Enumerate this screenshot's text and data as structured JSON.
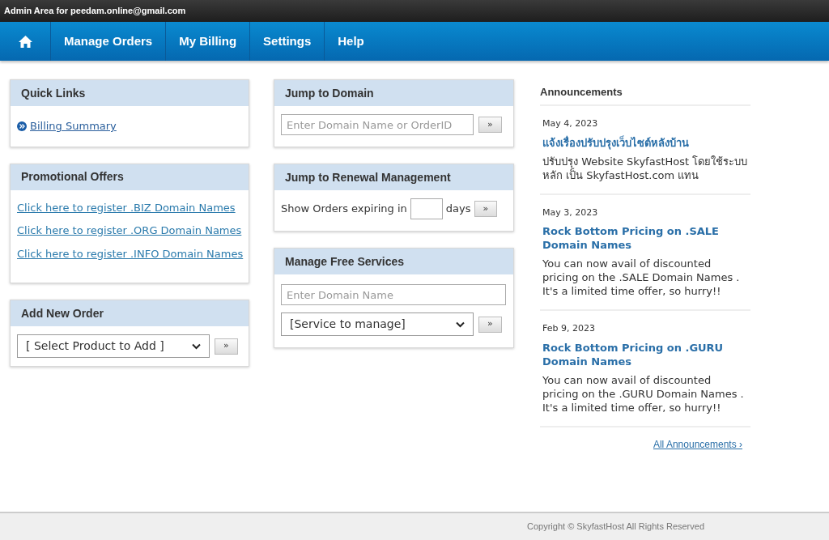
{
  "top_bar": {
    "text": "Admin Area for peedam.online@gmail.com"
  },
  "nav": {
    "items": [
      "Manage Orders",
      "My Billing",
      "Settings",
      "Help"
    ]
  },
  "quick_links": {
    "title": "Quick Links",
    "links": [
      "Billing Summary"
    ]
  },
  "promotional_offers": {
    "title": "Promotional Offers",
    "links": [
      "Click here to register .BIZ Domain Names",
      "Click here to register .ORG Domain Names",
      "Click here to register .INFO Domain Names"
    ]
  },
  "add_new_order": {
    "title": "Add New Order",
    "select": "[ Select Product to Add ]",
    "button": "»"
  },
  "jump_to_domain": {
    "title": "Jump to Domain",
    "placeholder": "Enter Domain Name or OrderID",
    "button": "»"
  },
  "renewal": {
    "title": "Jump to Renewal Management",
    "label": "Show Orders expiring in",
    "suffix": "days",
    "button": "»"
  },
  "free_services": {
    "title": "Manage Free Services",
    "placeholder": "Enter Domain Name",
    "select": "[Service to manage]",
    "button": "»"
  },
  "announcements": {
    "title": "Announcements",
    "items": [
      {
        "date": "May 4, 2023",
        "title": "แจ้งเรื่องปรับปรุงเว็บไซต์หลังบ้าน",
        "body": "ปรับปรุง Website SkyfastHost โดยใช้ระบบ หลัก เป็น SkyfastHost.com แทน"
      },
      {
        "date": "May 3, 2023",
        "title": "Rock Bottom Pricing on .SALE Domain Names",
        "body": "You can now avail of discounted pricing on the .SALE Domain Names . It's a limited time offer, so hurry!!"
      },
      {
        "date": "Feb 9, 2023",
        "title": "Rock Bottom Pricing on .GURU Domain Names",
        "body": "You can now avail of discounted pricing on the .GURU Domain Names . It's a limited time offer, so hurry!!"
      }
    ],
    "all_link": "All Announcements ›"
  },
  "footer": {
    "text": "Copyright © SkyfastHost All Rights Reserved"
  }
}
